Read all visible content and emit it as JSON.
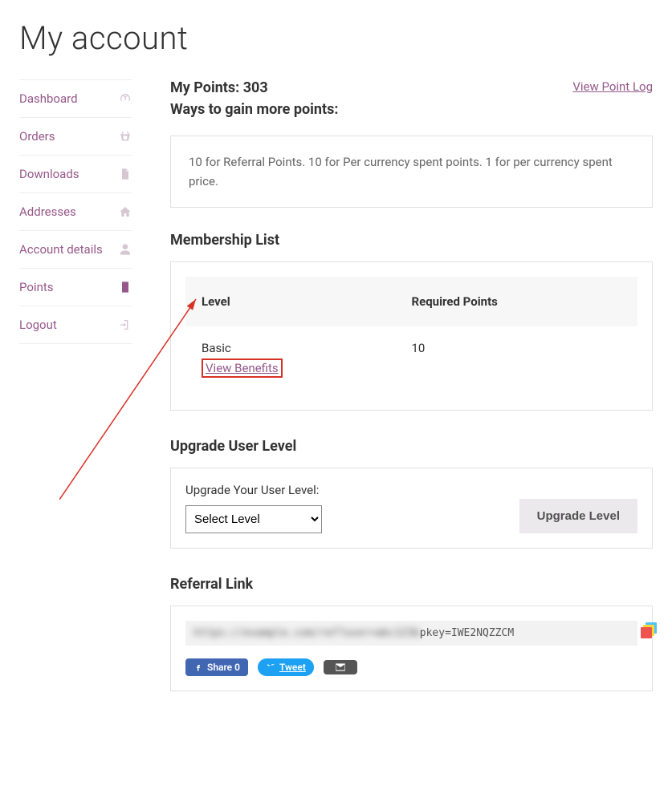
{
  "page_title": "My account",
  "sidebar": {
    "items": [
      {
        "label": "Dashboard",
        "icon": "dashboard-icon",
        "active": false
      },
      {
        "label": "Orders",
        "icon": "basket-icon",
        "active": false
      },
      {
        "label": "Downloads",
        "icon": "file-icon",
        "active": false
      },
      {
        "label": "Addresses",
        "icon": "home-icon",
        "active": false
      },
      {
        "label": "Account details",
        "icon": "user-icon",
        "active": false
      },
      {
        "label": "Points",
        "icon": "document-icon",
        "active": true
      },
      {
        "label": "Logout",
        "icon": "logout-icon",
        "active": false
      }
    ]
  },
  "points": {
    "heading_prefix": "My Points: ",
    "value": "303",
    "view_log": "View Point Log",
    "ways_heading": "Ways to gain more points:",
    "ways_text": "10 for Referral Points. 10 for Per currency spent points. 1 for per currency spent price."
  },
  "membership": {
    "heading": "Membership List",
    "col_level": "Level",
    "col_required": "Required Points",
    "row_level": "Basic",
    "row_required": "10",
    "view_benefits": "View Benefits"
  },
  "upgrade": {
    "heading": "Upgrade User Level",
    "label": "Upgrade Your User Level:",
    "select_placeholder": "Select Level",
    "button": "Upgrade Level"
  },
  "referral": {
    "heading": "Referral Link",
    "blurred_text": "https://example.com/ref?user=abc123&",
    "visible_text": "pkey=IWE2NQZZCM",
    "share_fb": "Share 0",
    "share_tw": "Tweet"
  }
}
